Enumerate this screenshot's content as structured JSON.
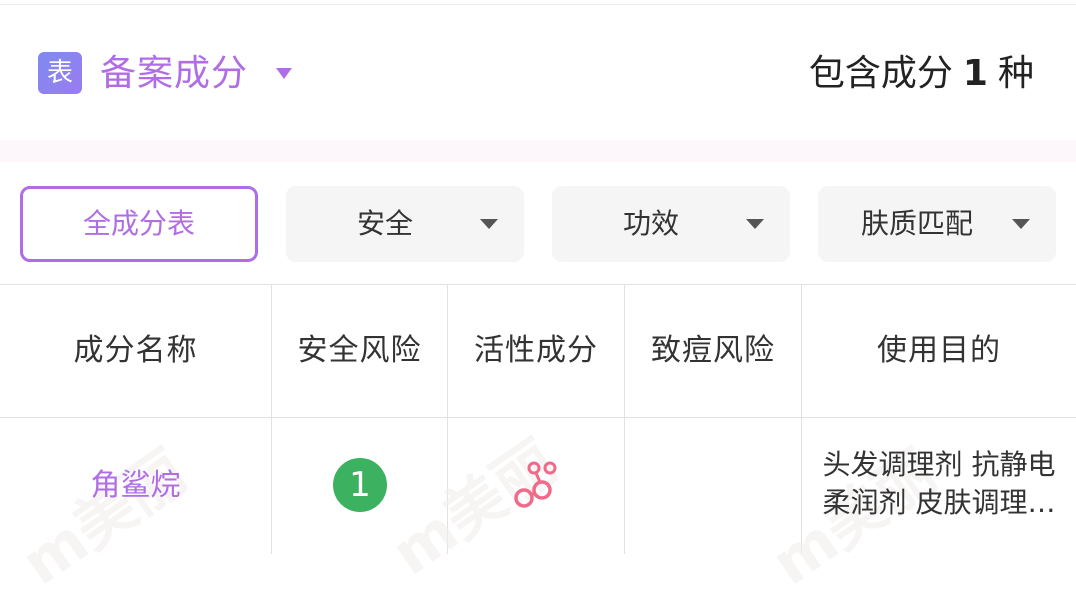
{
  "header": {
    "icon_text": "表",
    "title": "备案成分",
    "count_prefix": "包含成分",
    "count_value": "1",
    "count_suffix": "种"
  },
  "filters": [
    {
      "label": "全成分表",
      "active": true
    },
    {
      "label": "安全",
      "active": false
    },
    {
      "label": "功效",
      "active": false
    },
    {
      "label": "肤质匹配",
      "active": false
    }
  ],
  "table": {
    "columns": [
      "成分名称",
      "安全风险",
      "活性成分",
      "致痘风险",
      "使用目的"
    ],
    "rows": [
      {
        "name": "角鲨烷",
        "safety_risk": "1",
        "active_icon": "molecule-icon",
        "acne_risk": "",
        "purpose_line1": "头发调理剂 抗静电",
        "purpose_line2": "柔润剂 皮肤调理…"
      }
    ]
  },
  "colors": {
    "accent": "#b06ee6",
    "safe_badge": "#3cb15f",
    "molecule": "#f06a8a",
    "filter_bg": "#f5f5f5"
  }
}
